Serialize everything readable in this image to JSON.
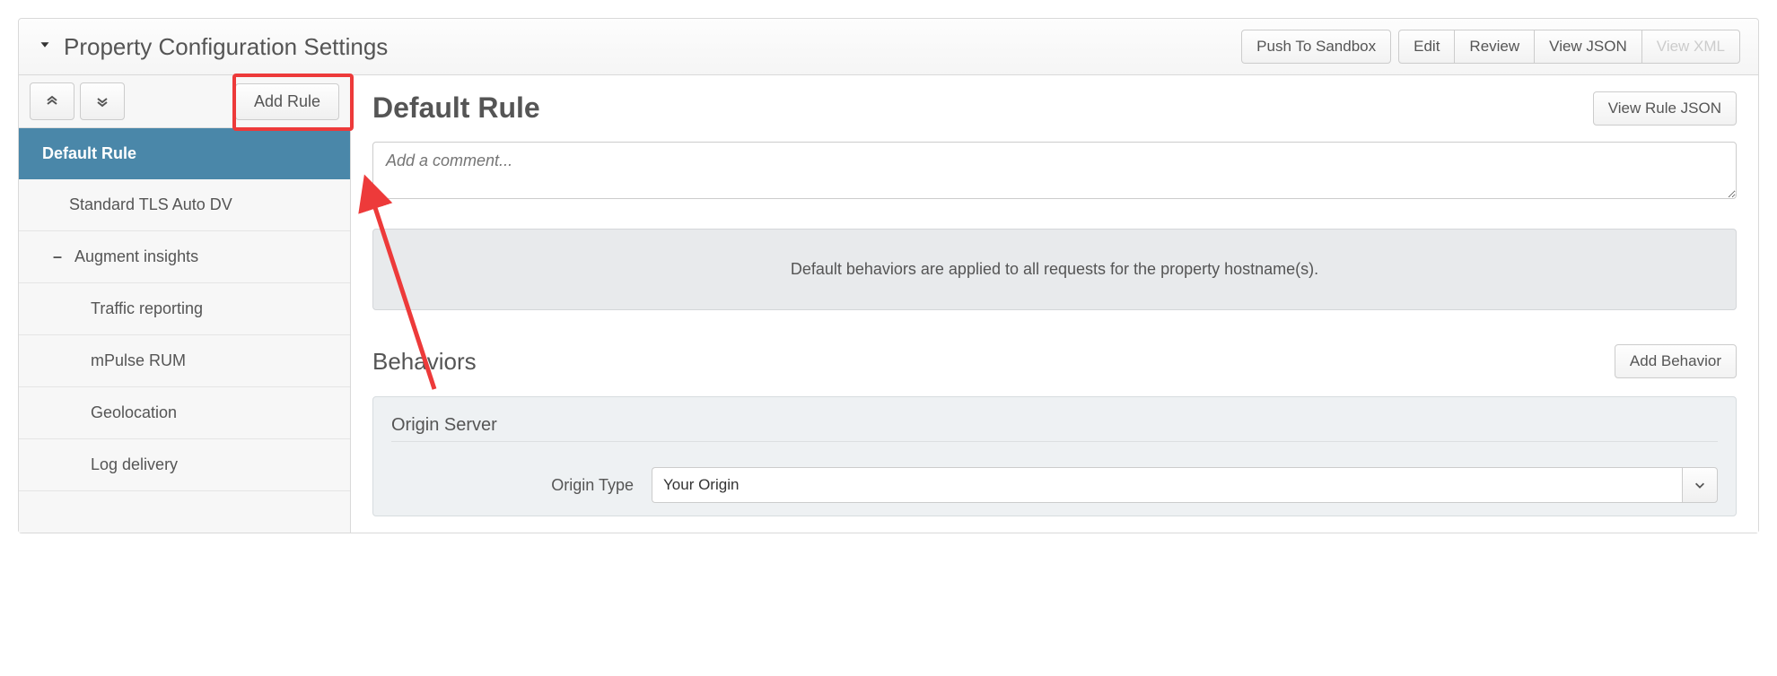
{
  "header": {
    "title": "Property Configuration Settings",
    "push_sandbox": "Push To Sandbox",
    "edit": "Edit",
    "review": "Review",
    "view_json": "View JSON",
    "view_xml": "View XML"
  },
  "sidebar": {
    "add_rule": "Add Rule",
    "items": [
      {
        "label": "Default Rule",
        "level": 0,
        "active": true,
        "expandable": false
      },
      {
        "label": "Standard TLS Auto DV",
        "level": 1,
        "active": false,
        "expandable": false
      },
      {
        "label": "Augment insights",
        "level": 1,
        "active": false,
        "expandable": true,
        "expanded": true
      },
      {
        "label": "Traffic reporting",
        "level": 2,
        "active": false,
        "expandable": false
      },
      {
        "label": "mPulse RUM",
        "level": 2,
        "active": false,
        "expandable": false
      },
      {
        "label": "Geolocation",
        "level": 2,
        "active": false,
        "expandable": false
      },
      {
        "label": "Log delivery",
        "level": 2,
        "active": false,
        "expandable": false
      }
    ]
  },
  "main": {
    "rule_title": "Default Rule",
    "view_rule_json": "View Rule JSON",
    "comment_placeholder": "Add a comment...",
    "info_text": "Default behaviors are applied to all requests for the property hostname(s).",
    "behaviors_title": "Behaviors",
    "add_behavior": "Add Behavior",
    "behavior": {
      "card_title": "Origin Server",
      "origin_type_label": "Origin Type",
      "origin_type_value": "Your Origin"
    }
  }
}
